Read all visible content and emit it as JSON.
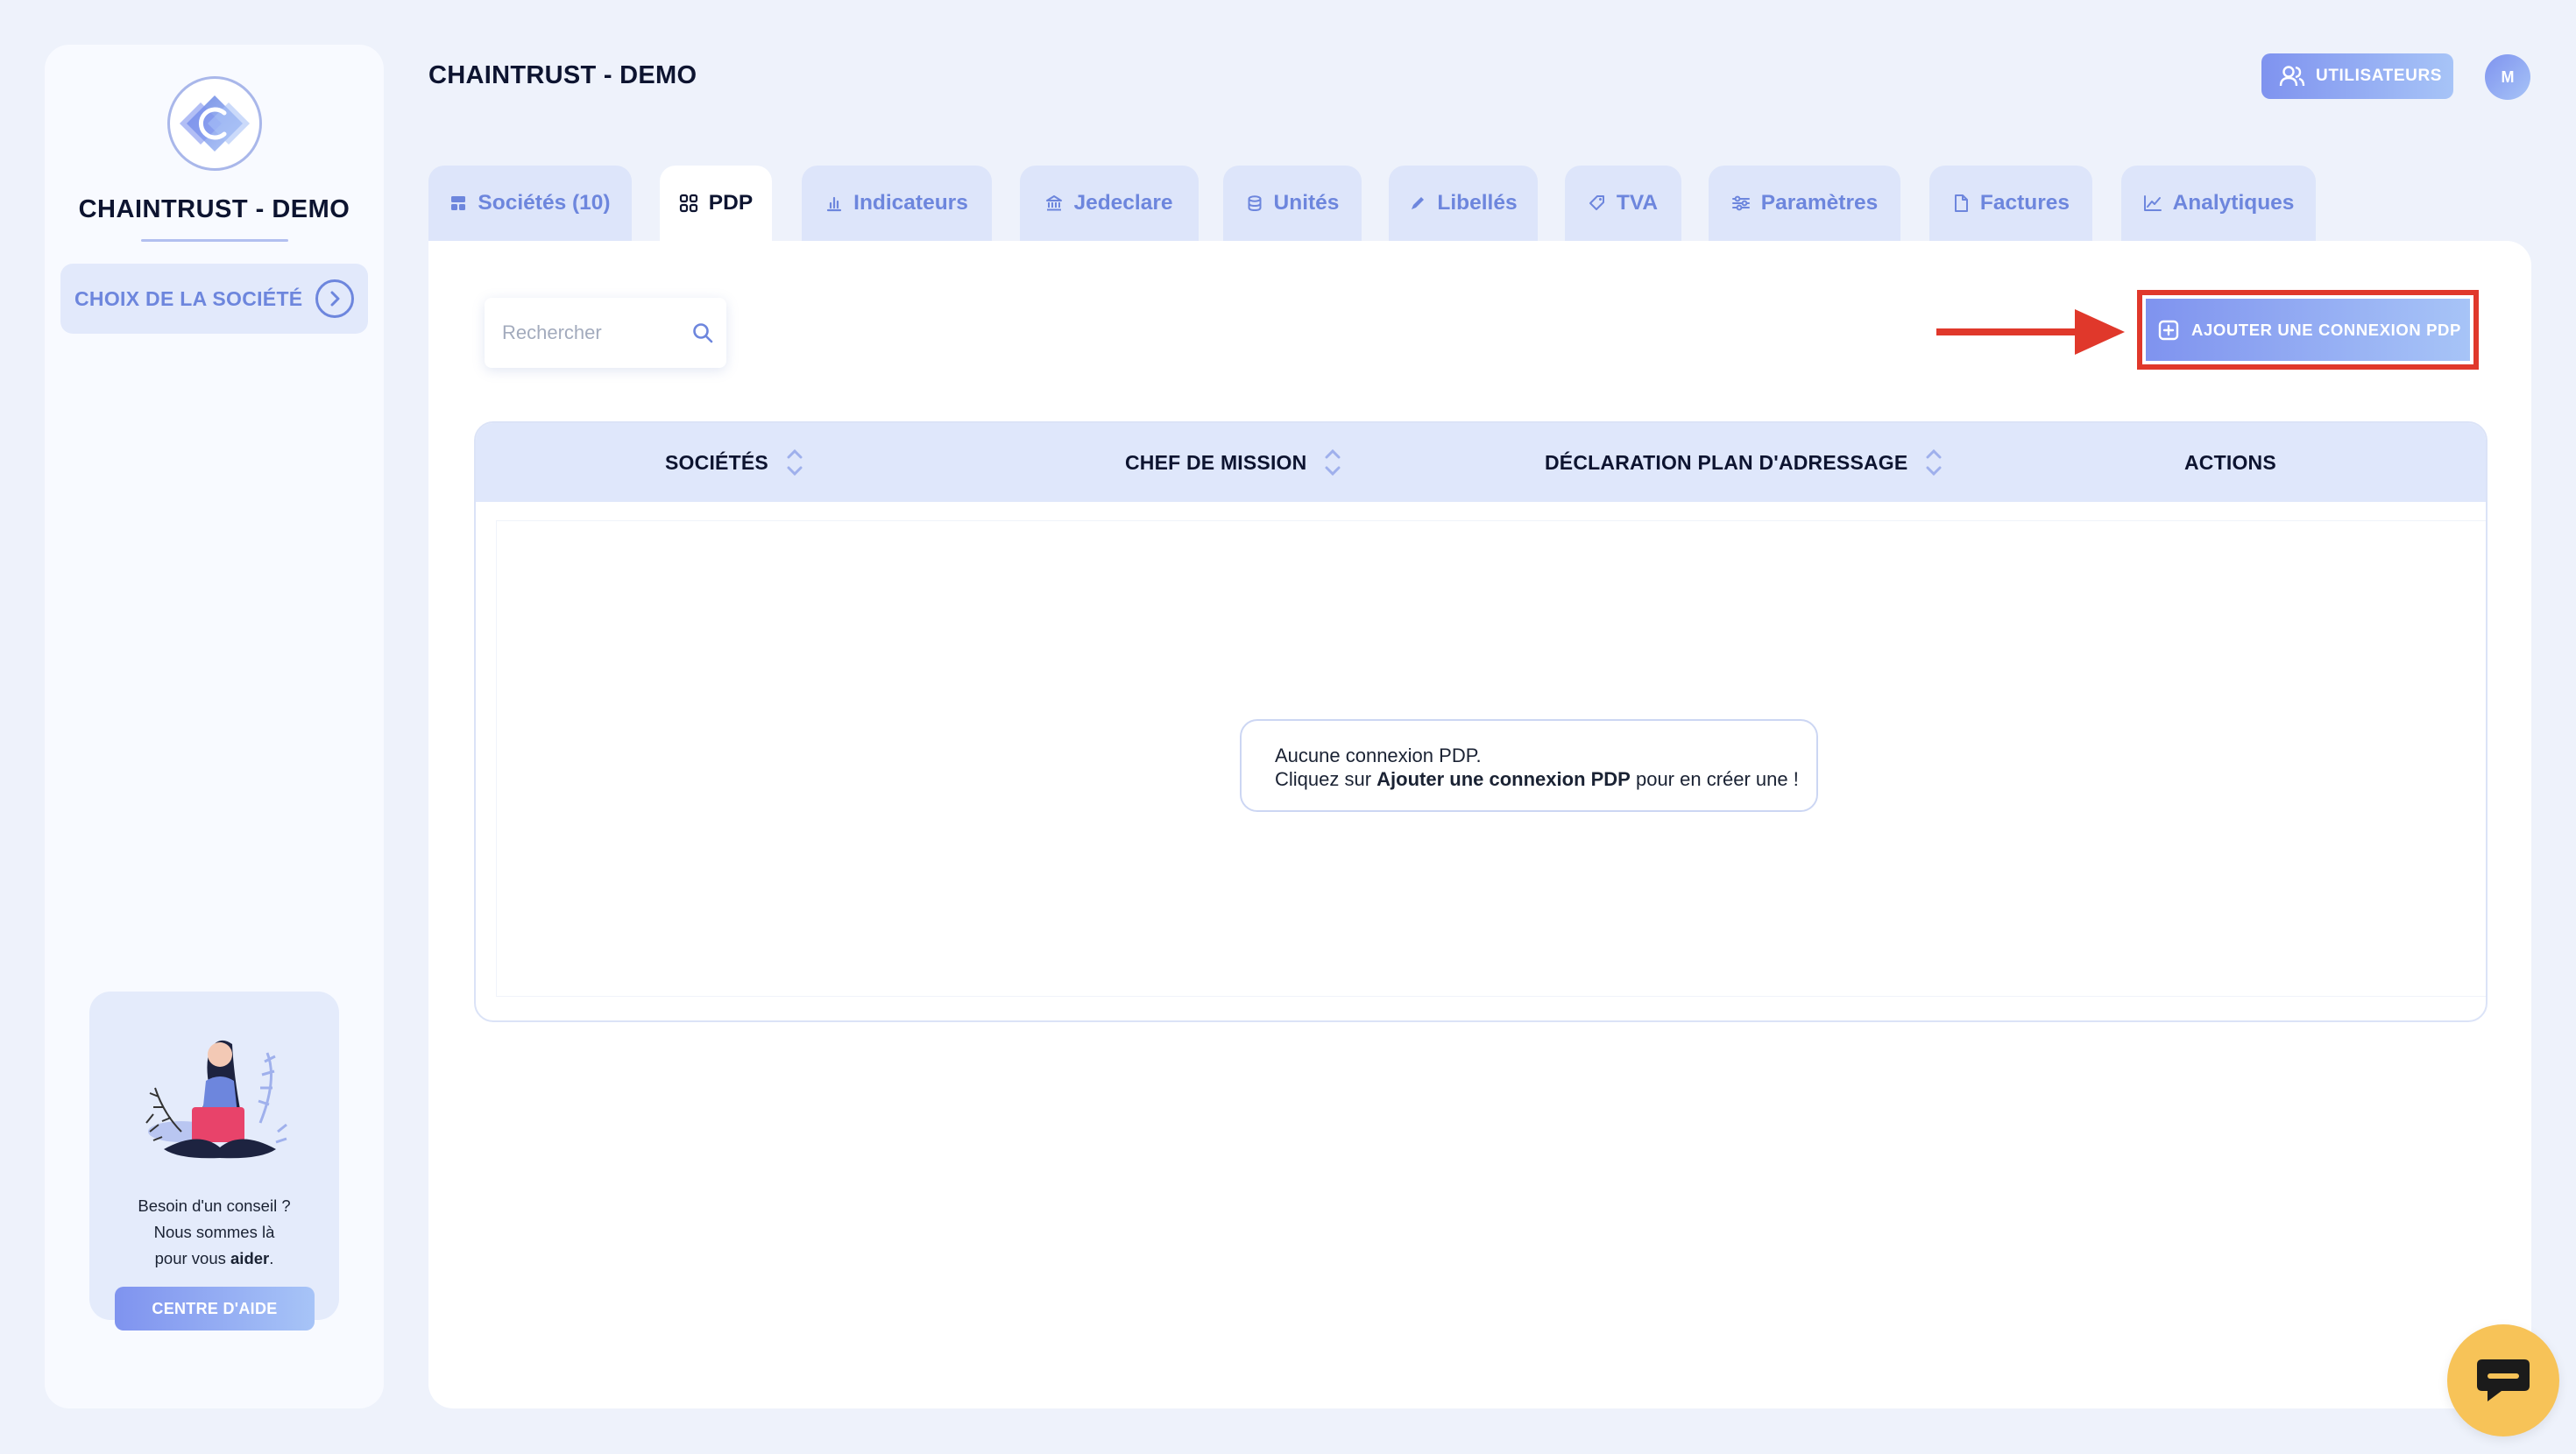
{
  "sidebar": {
    "company_name": "CHAINTRUST - DEMO",
    "choose_company_label": "CHOIX DE LA SOCIÉTÉ",
    "help": {
      "line1": "Besoin d'un conseil ?",
      "line2": "Nous sommes là",
      "line3_prefix": "pour vous ",
      "line3_bold": "aider",
      "line3_suffix": ".",
      "button_label": "CENTRE D'AIDE"
    }
  },
  "header": {
    "title": "CHAINTRUST - DEMO",
    "users_button_label": "UTILISATEURS",
    "avatar_initial": "M"
  },
  "tabs": [
    {
      "label": "Sociétés (10)",
      "icon": "building-icon",
      "active": false
    },
    {
      "label": "PDP",
      "icon": "grid-icon",
      "active": true
    },
    {
      "label": "Indicateurs",
      "icon": "bar-chart-icon",
      "active": false
    },
    {
      "label": "Jedeclare",
      "icon": "bank-icon",
      "active": false
    },
    {
      "label": "Unités",
      "icon": "database-icon",
      "active": false
    },
    {
      "label": "Libellés",
      "icon": "pen-icon",
      "active": false
    },
    {
      "label": "TVA",
      "icon": "tag-icon",
      "active": false
    },
    {
      "label": "Paramètres",
      "icon": "sliders-icon",
      "active": false
    },
    {
      "label": "Factures",
      "icon": "document-icon",
      "active": false
    },
    {
      "label": "Analytiques",
      "icon": "line-chart-icon",
      "active": false
    }
  ],
  "main": {
    "search": {
      "placeholder": "Rechercher",
      "value": ""
    },
    "add_button_label": "AJOUTER UNE CONNEXION PDP",
    "annotation_color": "#e0382b",
    "table": {
      "columns": [
        "SOCIÉTÉS",
        "CHEF DE MISSION",
        "DÉCLARATION PLAN D'ADRESSAGE",
        "ACTIONS"
      ],
      "rows": []
    },
    "empty_state": {
      "line1": "Aucune connexion PDP.",
      "line2_prefix": "Cliquez sur ",
      "line2_bold": "Ajouter une connexion PDP",
      "line2_suffix": " pour en créer une !"
    }
  },
  "colors": {
    "accent": "#6d86dd",
    "background": "#eef2fb",
    "chat": "#f7c358"
  }
}
